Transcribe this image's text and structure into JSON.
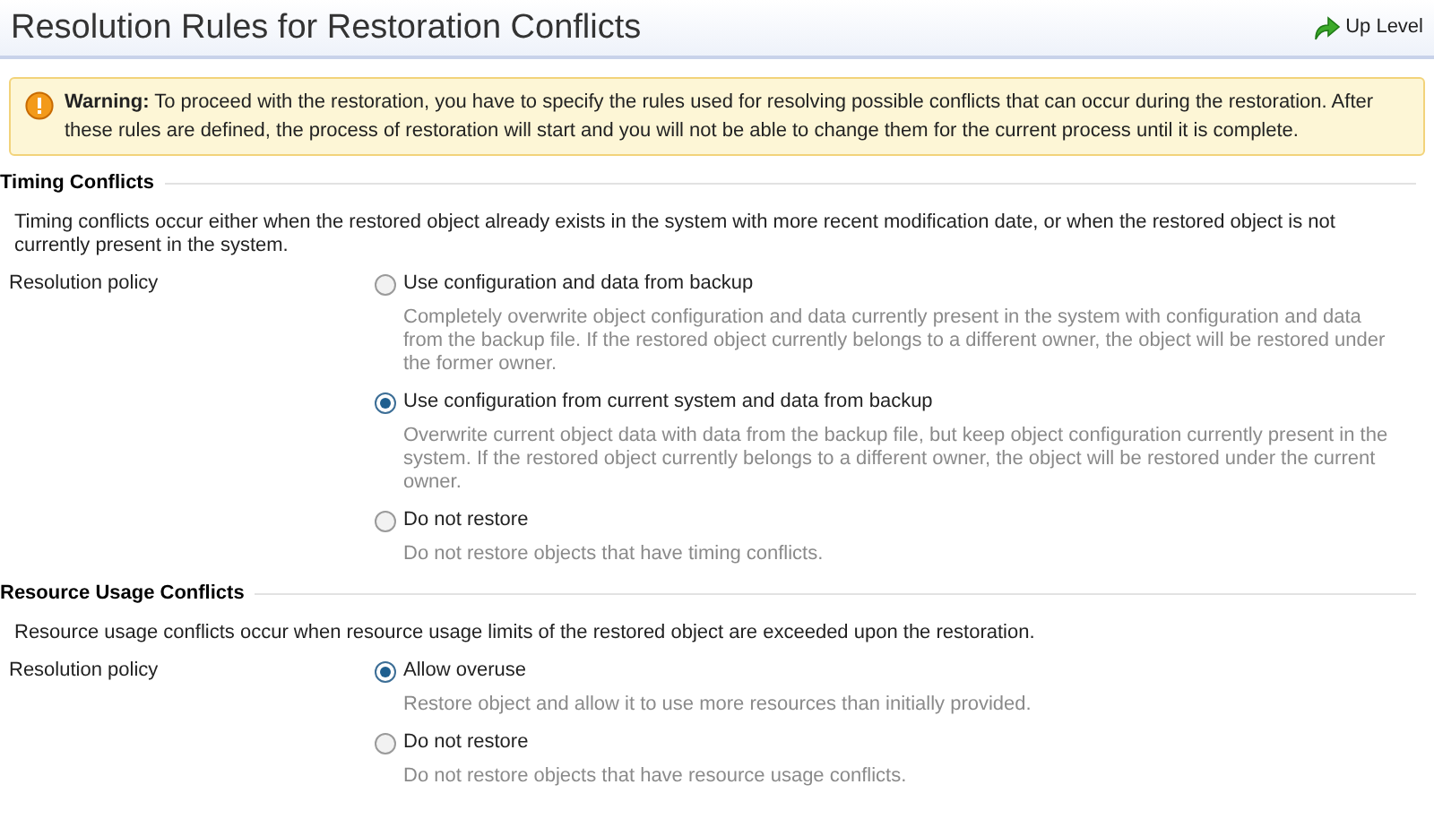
{
  "header": {
    "title": "Resolution Rules for Restoration Conflicts",
    "up_level": "Up Level"
  },
  "warning": {
    "label": "Warning:",
    "text": "To proceed with the restoration, you have to specify the rules used for resolving possible conflicts that can occur during the restoration. After these rules are defined, the process of restoration will start and you will not be able to change them for the current process until it is complete."
  },
  "sections": [
    {
      "title": "Timing Conflicts",
      "description": "Timing conflicts occur either when the restored object already exists in the system with more recent modification date, or when the restored object is not currently present in the system.",
      "policy_label": "Resolution policy",
      "options": [
        {
          "label": "Use configuration and data from backup",
          "description": "Completely overwrite object configuration and data currently present in the system with configuration and data from the backup file. If the restored object currently belongs to a different owner, the object will be restored under the former owner.",
          "selected": false
        },
        {
          "label": "Use configuration from current system and data from backup",
          "description": "Overwrite current object data with data from the backup file, but keep object configuration currently present in the system. If the restored object currently belongs to a different owner, the object will be restored under the current owner.",
          "selected": true
        },
        {
          "label": "Do not restore",
          "description": "Do not restore objects that have timing conflicts.",
          "selected": false
        }
      ]
    },
    {
      "title": "Resource Usage Conflicts",
      "description": "Resource usage conflicts occur when resource usage limits of the restored object are exceeded upon the restoration.",
      "policy_label": "Resolution policy",
      "options": [
        {
          "label": "Allow overuse",
          "description": "Restore object and allow it to use more resources than initially provided.",
          "selected": true
        },
        {
          "label": "Do not restore",
          "description": "Do not restore objects that have resource usage conflicts.",
          "selected": false
        }
      ]
    }
  ]
}
